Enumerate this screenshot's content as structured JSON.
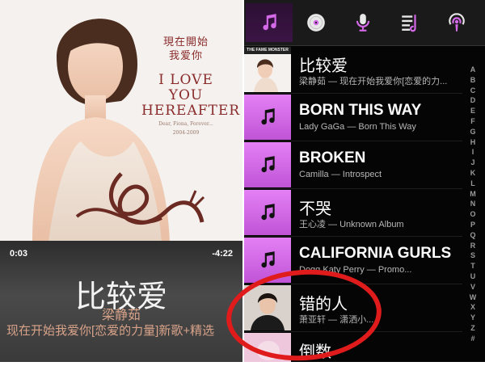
{
  "cover": {
    "title_zh_line1": "現在開始",
    "title_zh_line2": "我爱你",
    "title_en_line1": "I LOVE YOU",
    "title_en_line2": "HEREAFTER",
    "tagline": "Dear, Fiona, Forever...",
    "years": "2004-2009"
  },
  "player": {
    "elapsed": "0:03",
    "remaining": "-4:22",
    "title": "比较爱",
    "artist": "梁静茹",
    "album": "现在开始我爱你[恋爱的力量]新歌+精选"
  },
  "tabs": [
    {
      "icon": "music-note-icon",
      "active": true
    },
    {
      "icon": "disc-icon",
      "active": false
    },
    {
      "icon": "microphone-icon",
      "active": false
    },
    {
      "icon": "playlist-icon",
      "active": false
    },
    {
      "icon": "podcast-icon",
      "active": false
    }
  ],
  "songs": [
    {
      "title": "比较爱",
      "subtitle": "梁静茹 — 现在开始我爱你[恋爱的力...",
      "thumb": "album-art",
      "overlay": "THE FAME MONSTER"
    },
    {
      "title": "BORN THIS WAY",
      "subtitle": "Lady GaGa — Born This Way",
      "thumb": "note"
    },
    {
      "title": "BROKEN",
      "subtitle": "Camilla — Introspect",
      "thumb": "note"
    },
    {
      "title": "不哭",
      "subtitle": "王心凌 — Unknown Album",
      "thumb": "note"
    },
    {
      "title": "CALIFORNIA GURLS",
      "subtitle": "Dogg Katy Perry — Promo...",
      "thumb": "note"
    },
    {
      "title": "错的人",
      "subtitle": "萧亚轩 — 潇洒小...",
      "thumb": "photo"
    },
    {
      "title": "倒数",
      "subtitle": "",
      "thumb": "photo2"
    }
  ],
  "alphabet": [
    "A",
    "B",
    "C",
    "D",
    "E",
    "F",
    "G",
    "H",
    "I",
    "J",
    "K",
    "L",
    "M",
    "N",
    "O",
    "P",
    "Q",
    "R",
    "S",
    "T",
    "U",
    "V",
    "W",
    "X",
    "Y",
    "Z",
    "#"
  ],
  "colors": {
    "accent": "#d46ae8",
    "highlight_circle": "#e01b1b",
    "list_background": "#050505",
    "album_text": "#d9a38a"
  }
}
